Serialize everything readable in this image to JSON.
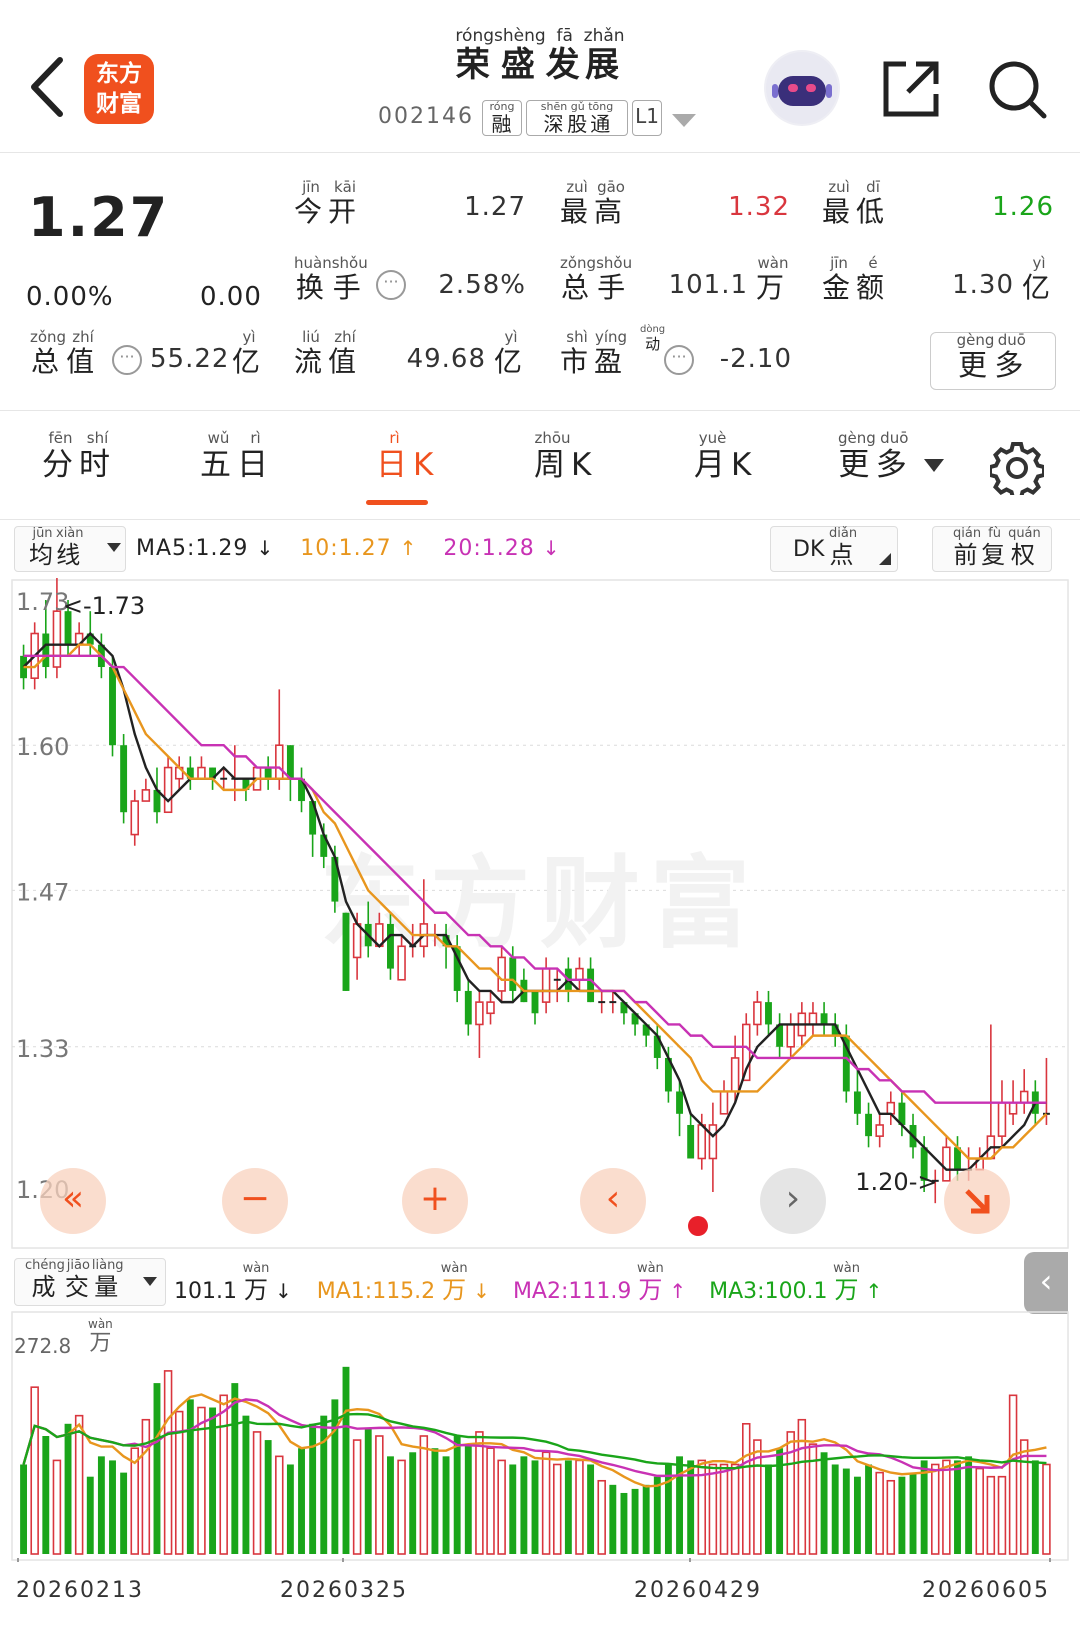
{
  "header": {
    "logo_line1": "东方",
    "logo_line2": "财富",
    "title_chars": [
      {
        "c": "荣",
        "p": "róng"
      },
      {
        "c": "盛",
        "p": "shèng"
      },
      {
        "c": "发",
        "p": "fā"
      },
      {
        "c": "展",
        "p": "zhǎn"
      }
    ],
    "stock_code": "002146",
    "tags": [
      {
        "chars": [
          {
            "c": "融",
            "p": "róng"
          }
        ]
      },
      {
        "chars": [
          {
            "c": "深",
            "p": "shēn"
          },
          {
            "c": "股",
            "p": "gǔ"
          },
          {
            "c": "通",
            "p": "tōng"
          }
        ]
      },
      {
        "chars": [
          {
            "c": "L1",
            "p": ""
          }
        ]
      }
    ]
  },
  "quote": {
    "price": "1.27",
    "change_pct": "0.00%",
    "change": "0.00",
    "open_label": [
      {
        "c": "今",
        "p": "jīn"
      },
      {
        "c": "开",
        "p": "kāi"
      }
    ],
    "open": "1.27",
    "high_label": [
      {
        "c": "最",
        "p": "zuì"
      },
      {
        "c": "高",
        "p": "gāo"
      }
    ],
    "high": "1.32",
    "low_label": [
      {
        "c": "最",
        "p": "zuì"
      },
      {
        "c": "低",
        "p": "dī"
      }
    ],
    "low": "1.26",
    "turnover_label": [
      {
        "c": "换",
        "p": "huàn"
      },
      {
        "c": "手",
        "p": "shǒu"
      }
    ],
    "turnover": "2.58%",
    "volume_label": [
      {
        "c": "总",
        "p": "zǒng"
      },
      {
        "c": "手",
        "p": "shǒu"
      }
    ],
    "volume": "101.1",
    "volume_unit": {
      "c": "万",
      "p": "wàn"
    },
    "amount_label": [
      {
        "c": "金",
        "p": "jīn"
      },
      {
        "c": "额",
        "p": "é"
      }
    ],
    "amount": "1.30",
    "amount_unit": {
      "c": "亿",
      "p": "yì"
    },
    "mktcap_label": [
      {
        "c": "总",
        "p": "zǒng"
      },
      {
        "c": "值",
        "p": "zhí"
      }
    ],
    "mktcap": "55.22",
    "mktcap_unit": {
      "c": "亿",
      "p": "yì"
    },
    "float_label": [
      {
        "c": "流",
        "p": "liú"
      },
      {
        "c": "值",
        "p": "zhí"
      }
    ],
    "float_cap": "49.68",
    "float_unit": {
      "c": "亿",
      "p": "yì"
    },
    "pe_label": [
      {
        "c": "市",
        "p": "shì"
      },
      {
        "c": "盈",
        "p": "yíng"
      }
    ],
    "pe_sup": {
      "c": "动",
      "p": "dòng"
    },
    "pe": "-2.10",
    "more": [
      {
        "c": "更",
        "p": "gèng"
      },
      {
        "c": "多",
        "p": "duō"
      }
    ],
    "info_glyph": "···",
    "colors": {
      "up": "#d9363e",
      "down": "#1aa51a"
    }
  },
  "tabs": [
    {
      "chars": [
        {
          "c": "分",
          "p": "fēn"
        },
        {
          "c": "时",
          "p": "shí"
        }
      ],
      "active": false
    },
    {
      "chars": [
        {
          "c": "五",
          "p": "wǔ"
        },
        {
          "c": "日",
          "p": "rì"
        }
      ],
      "active": false
    },
    {
      "chars": [
        {
          "c": "日",
          "p": "rì"
        },
        {
          "c": "K",
          "p": ""
        }
      ],
      "active": true
    },
    {
      "chars": [
        {
          "c": "周",
          "p": "zhōu"
        },
        {
          "c": "K",
          "p": ""
        }
      ],
      "active": false
    },
    {
      "chars": [
        {
          "c": "月",
          "p": "yuè"
        },
        {
          "c": "K",
          "p": ""
        }
      ],
      "active": false
    },
    {
      "chars": [
        {
          "c": "更",
          "p": "gèng"
        },
        {
          "c": "多",
          "p": "duō"
        }
      ],
      "active": false
    }
  ],
  "kline_controls": {
    "ma_selector": [
      {
        "c": "均",
        "p": "jūn"
      },
      {
        "c": "线",
        "p": "xiàn"
      }
    ],
    "ma5": "MA5:1.29",
    "ma10": "10:1.27",
    "ma20": "20:1.28",
    "ma5_arrow": "↓",
    "ma10_arrow": "↑",
    "ma20_arrow": "↓",
    "dk_prefix": "DK",
    "dk_chars": [
      {
        "c": "点",
        "p": "diǎn"
      }
    ],
    "adjust": [
      {
        "c": "前",
        "p": "qián"
      },
      {
        "c": "复",
        "p": "fù"
      },
      {
        "c": "权",
        "p": "quán"
      }
    ],
    "ma_colors": {
      "ma5": "#222222",
      "ma10": "#e8961e",
      "ma20": "#c832b4"
    }
  },
  "volume_controls": {
    "selector": [
      {
        "c": "成",
        "p": "chéng"
      },
      {
        "c": "交",
        "p": "jiāo"
      },
      {
        "c": "量",
        "p": "liàng"
      }
    ],
    "vol": "101.1",
    "vol_arrow": "↓",
    "ma1": "MA1:115.2",
    "ma1_arrow": "↓",
    "ma2": "MA2:111.9",
    "ma2_arrow": "↑",
    "ma3": "MA3:100.1",
    "ma3_arrow": "↑",
    "unit": {
      "c": "万",
      "p": "wàn"
    },
    "ma_colors": {
      "ma1": "#e8961e",
      "ma2": "#c832b4",
      "ma3": "#1aa51a"
    }
  },
  "nav": {
    "first": "«",
    "zoom_out": "−",
    "zoom_in": "+",
    "prev": "‹",
    "next": "›",
    "collapse": "‹"
  },
  "watermark": "东方财富",
  "chart_data": [
    {
      "type": "candlestick",
      "y_ticks": [
        "1.73",
        "1.60",
        "1.47",
        "1.33",
        "1.20"
      ],
      "ylim": [
        1.2,
        1.73
      ],
      "annotations": {
        "high": "1.73",
        "low": "1.20"
      },
      "candles": [
        [
          1.68,
          1.66,
          1.69,
          1.65
        ],
        [
          1.66,
          1.7,
          1.71,
          1.65
        ],
        [
          1.7,
          1.67,
          1.73,
          1.66
        ],
        [
          1.67,
          1.72,
          1.75,
          1.66
        ],
        [
          1.72,
          1.69,
          1.73,
          1.68
        ],
        [
          1.69,
          1.7,
          1.71,
          1.68
        ],
        [
          1.7,
          1.69,
          1.72,
          1.68
        ],
        [
          1.69,
          1.67,
          1.7,
          1.66
        ],
        [
          1.67,
          1.6,
          1.68,
          1.59
        ],
        [
          1.6,
          1.54,
          1.61,
          1.53
        ],
        [
          1.52,
          1.55,
          1.56,
          1.51
        ],
        [
          1.55,
          1.56,
          1.57,
          1.55
        ],
        [
          1.56,
          1.54,
          1.58,
          1.53
        ],
        [
          1.54,
          1.58,
          1.59,
          1.54
        ],
        [
          1.57,
          1.58,
          1.59,
          1.56
        ],
        [
          1.58,
          1.57,
          1.59,
          1.56
        ],
        [
          1.57,
          1.58,
          1.59,
          1.57
        ],
        [
          1.58,
          1.57,
          1.58,
          1.56
        ],
        [
          1.57,
          1.57,
          1.58,
          1.56
        ],
        [
          1.57,
          1.57,
          1.6,
          1.55
        ],
        [
          1.57,
          1.56,
          1.57,
          1.55
        ],
        [
          1.56,
          1.58,
          1.58,
          1.56
        ],
        [
          1.58,
          1.57,
          1.59,
          1.56
        ],
        [
          1.57,
          1.6,
          1.65,
          1.56
        ],
        [
          1.6,
          1.57,
          1.6,
          1.55
        ],
        [
          1.57,
          1.55,
          1.58,
          1.54
        ],
        [
          1.55,
          1.52,
          1.55,
          1.5
        ],
        [
          1.52,
          1.5,
          1.53,
          1.49
        ],
        [
          1.5,
          1.46,
          1.51,
          1.45
        ],
        [
          1.45,
          1.38,
          1.45,
          1.38
        ],
        [
          1.41,
          1.44,
          1.45,
          1.39
        ],
        [
          1.44,
          1.42,
          1.46,
          1.41
        ],
        [
          1.42,
          1.44,
          1.45,
          1.42
        ],
        [
          1.44,
          1.4,
          1.45,
          1.39
        ],
        [
          1.39,
          1.42,
          1.43,
          1.39
        ],
        [
          1.42,
          1.42,
          1.44,
          1.41
        ],
        [
          1.42,
          1.44,
          1.48,
          1.41
        ],
        [
          1.43,
          1.43,
          1.44,
          1.42
        ],
        [
          1.43,
          1.42,
          1.44,
          1.4
        ],
        [
          1.42,
          1.38,
          1.43,
          1.37
        ],
        [
          1.38,
          1.35,
          1.39,
          1.34
        ],
        [
          1.35,
          1.37,
          1.38,
          1.32
        ],
        [
          1.36,
          1.37,
          1.38,
          1.35
        ],
        [
          1.38,
          1.41,
          1.42,
          1.37
        ],
        [
          1.41,
          1.38,
          1.42,
          1.37
        ],
        [
          1.39,
          1.37,
          1.4,
          1.37
        ],
        [
          1.38,
          1.36,
          1.38,
          1.35
        ],
        [
          1.37,
          1.4,
          1.41,
          1.36
        ],
        [
          1.39,
          1.39,
          1.4,
          1.37
        ],
        [
          1.4,
          1.38,
          1.41,
          1.37
        ],
        [
          1.39,
          1.4,
          1.41,
          1.38
        ],
        [
          1.4,
          1.37,
          1.41,
          1.37
        ],
        [
          1.37,
          1.37,
          1.38,
          1.36
        ],
        [
          1.37,
          1.37,
          1.38,
          1.36
        ],
        [
          1.37,
          1.36,
          1.37,
          1.35
        ],
        [
          1.36,
          1.35,
          1.36,
          1.34
        ],
        [
          1.35,
          1.34,
          1.35,
          1.33
        ],
        [
          1.34,
          1.32,
          1.35,
          1.31
        ],
        [
          1.32,
          1.29,
          1.33,
          1.28
        ],
        [
          1.29,
          1.27,
          1.3,
          1.25
        ],
        [
          1.26,
          1.23,
          1.27,
          1.23
        ],
        [
          1.23,
          1.26,
          1.27,
          1.22
        ],
        [
          1.23,
          1.26,
          1.28,
          1.2
        ],
        [
          1.27,
          1.29,
          1.3,
          1.27
        ],
        [
          1.29,
          1.32,
          1.34,
          1.28
        ],
        [
          1.3,
          1.35,
          1.36,
          1.3
        ],
        [
          1.35,
          1.37,
          1.38,
          1.34
        ],
        [
          1.37,
          1.35,
          1.38,
          1.34
        ],
        [
          1.35,
          1.33,
          1.36,
          1.32
        ],
        [
          1.33,
          1.35,
          1.36,
          1.32
        ],
        [
          1.34,
          1.36,
          1.37,
          1.33
        ],
        [
          1.35,
          1.36,
          1.37,
          1.34
        ],
        [
          1.36,
          1.35,
          1.37,
          1.34
        ],
        [
          1.35,
          1.34,
          1.36,
          1.33
        ],
        [
          1.34,
          1.29,
          1.35,
          1.28
        ],
        [
          1.29,
          1.27,
          1.31,
          1.26
        ],
        [
          1.27,
          1.25,
          1.28,
          1.24
        ],
        [
          1.25,
          1.26,
          1.27,
          1.24
        ],
        [
          1.27,
          1.28,
          1.29,
          1.26
        ],
        [
          1.28,
          1.26,
          1.29,
          1.25
        ],
        [
          1.26,
          1.24,
          1.27,
          1.23
        ],
        [
          1.24,
          1.21,
          1.25,
          1.2
        ],
        [
          1.21,
          1.21,
          1.22,
          1.19
        ],
        [
          1.21,
          1.24,
          1.25,
          1.21
        ],
        [
          1.24,
          1.22,
          1.25,
          1.21
        ],
        [
          1.22,
          1.22,
          1.24,
          1.21
        ],
        [
          1.22,
          1.23,
          1.24,
          1.22
        ],
        [
          1.23,
          1.25,
          1.35,
          1.23
        ],
        [
          1.25,
          1.28,
          1.3,
          1.24
        ],
        [
          1.27,
          1.28,
          1.3,
          1.26
        ],
        [
          1.28,
          1.29,
          1.31,
          1.27
        ],
        [
          1.29,
          1.27,
          1.3,
          1.26
        ],
        [
          1.27,
          1.27,
          1.32,
          1.26
        ]
      ],
      "ma5": [
        1.67,
        1.68,
        1.69,
        1.69,
        1.69,
        1.69,
        1.7,
        1.69,
        1.68,
        1.65,
        1.61,
        1.58,
        1.56,
        1.55,
        1.56,
        1.57,
        1.57,
        1.57,
        1.58,
        1.57,
        1.57,
        1.57,
        1.57,
        1.57,
        1.57,
        1.57,
        1.55,
        1.52,
        1.5,
        1.46,
        1.44,
        1.43,
        1.42,
        1.43,
        1.43,
        1.42,
        1.43,
        1.43,
        1.43,
        1.41,
        1.39,
        1.38,
        1.38,
        1.37,
        1.37,
        1.38,
        1.38,
        1.38,
        1.38,
        1.39,
        1.38,
        1.38,
        1.38,
        1.38,
        1.37,
        1.36,
        1.35,
        1.34,
        1.32,
        1.3,
        1.27,
        1.26,
        1.25,
        1.26,
        1.28,
        1.31,
        1.33,
        1.34,
        1.35,
        1.35,
        1.35,
        1.35,
        1.35,
        1.35,
        1.33,
        1.31,
        1.29,
        1.27,
        1.27,
        1.26,
        1.25,
        1.24,
        1.23,
        1.22,
        1.22,
        1.22,
        1.23,
        1.24,
        1.24,
        1.25,
        1.26,
        1.28,
        1.28
      ],
      "ma10": [
        1.67,
        1.67,
        1.68,
        1.68,
        1.68,
        1.69,
        1.69,
        1.68,
        1.67,
        1.65,
        1.63,
        1.61,
        1.6,
        1.59,
        1.58,
        1.57,
        1.57,
        1.57,
        1.56,
        1.56,
        1.56,
        1.57,
        1.57,
        1.57,
        1.57,
        1.57,
        1.56,
        1.54,
        1.53,
        1.51,
        1.49,
        1.47,
        1.46,
        1.45,
        1.44,
        1.43,
        1.43,
        1.43,
        1.42,
        1.42,
        1.41,
        1.4,
        1.4,
        1.39,
        1.39,
        1.38,
        1.38,
        1.38,
        1.38,
        1.38,
        1.38,
        1.38,
        1.38,
        1.38,
        1.38,
        1.37,
        1.36,
        1.35,
        1.34,
        1.33,
        1.32,
        1.3,
        1.29,
        1.29,
        1.29,
        1.29,
        1.29,
        1.3,
        1.31,
        1.32,
        1.33,
        1.34,
        1.34,
        1.34,
        1.34,
        1.33,
        1.32,
        1.31,
        1.3,
        1.29,
        1.28,
        1.27,
        1.26,
        1.25,
        1.24,
        1.23,
        1.23,
        1.23,
        1.24,
        1.24,
        1.25,
        1.26,
        1.27
      ],
      "ma20": [
        1.68,
        1.68,
        1.68,
        1.68,
        1.68,
        1.68,
        1.68,
        1.68,
        1.67,
        1.67,
        1.66,
        1.65,
        1.64,
        1.63,
        1.62,
        1.61,
        1.6,
        1.6,
        1.6,
        1.59,
        1.59,
        1.58,
        1.58,
        1.58,
        1.57,
        1.57,
        1.56,
        1.55,
        1.54,
        1.53,
        1.52,
        1.51,
        1.5,
        1.49,
        1.48,
        1.47,
        1.46,
        1.45,
        1.45,
        1.44,
        1.43,
        1.43,
        1.42,
        1.42,
        1.41,
        1.41,
        1.4,
        1.4,
        1.4,
        1.39,
        1.39,
        1.39,
        1.38,
        1.38,
        1.38,
        1.37,
        1.37,
        1.36,
        1.35,
        1.35,
        1.34,
        1.34,
        1.33,
        1.33,
        1.33,
        1.33,
        1.32,
        1.32,
        1.32,
        1.32,
        1.32,
        1.32,
        1.32,
        1.32,
        1.32,
        1.31,
        1.31,
        1.3,
        1.3,
        1.29,
        1.29,
        1.29,
        1.28,
        1.28,
        1.28,
        1.28,
        1.28,
        1.28,
        1.28,
        1.28,
        1.28,
        1.28,
        1.28
      ]
    },
    {
      "type": "bar",
      "y_ticks": [
        "272.8"
      ],
      "y_unit": {
        "c": "万",
        "p": "wàn"
      },
      "ylim": [
        0,
        272.8
      ],
      "x_labels": [
        "20260213",
        "20260325",
        "20260429",
        "20260605"
      ],
      "values": [
        110,
        205,
        145,
        115,
        160,
        170,
        95,
        120,
        115,
        100,
        130,
        165,
        210,
        225,
        175,
        190,
        180,
        180,
        195,
        210,
        170,
        150,
        140,
        120,
        110,
        130,
        160,
        170,
        190,
        230,
        140,
        155,
        145,
        120,
        115,
        125,
        145,
        130,
        120,
        145,
        135,
        150,
        130,
        115,
        110,
        120,
        115,
        125,
        110,
        115,
        115,
        110,
        90,
        85,
        75,
        80,
        85,
        95,
        110,
        120,
        115,
        115,
        110,
        110,
        110,
        160,
        140,
        110,
        130,
        150,
        165,
        135,
        125,
        110,
        105,
        95,
        110,
        100,
        90,
        95,
        100,
        115,
        110,
        115,
        115,
        120,
        105,
        95,
        95,
        195,
        140,
        115,
        110
      ]
    }
  ]
}
